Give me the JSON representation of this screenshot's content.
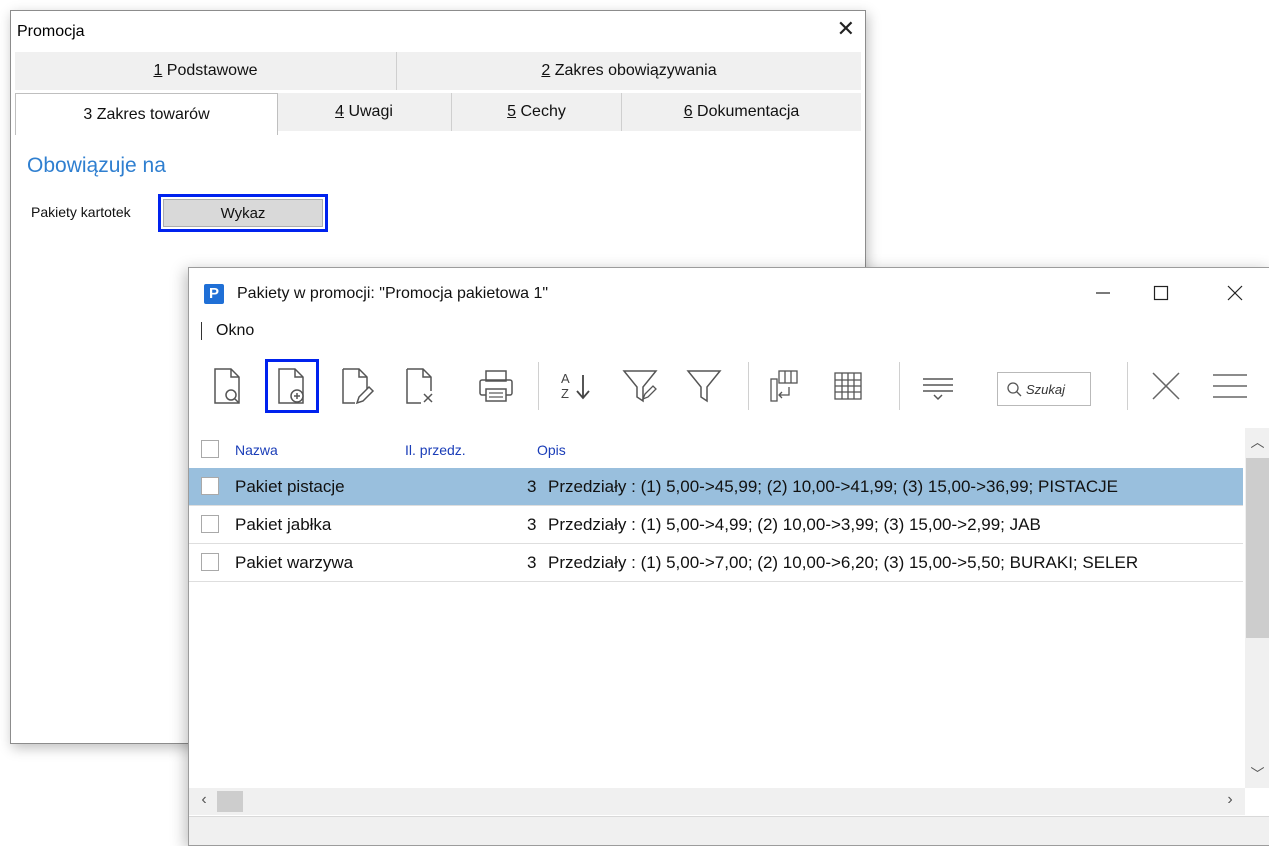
{
  "promocja": {
    "title": "Promocja",
    "tabs_row1": [
      {
        "num": "1",
        "label": " Podstawowe"
      },
      {
        "num": "2",
        "label": " Zakres obowiązywania"
      }
    ],
    "tabs_row2": [
      {
        "num": "3",
        "label": " Zakres towarów"
      },
      {
        "num": "4",
        "label": " Uwagi"
      },
      {
        "num": "5",
        "label": " Cechy"
      },
      {
        "num": "6",
        "label": " Dokumentacja"
      }
    ],
    "section_title": "Obowiązuje na",
    "field_label": "Pakiety kartotek",
    "wykaz_label": "Wykaz"
  },
  "pakiety": {
    "app_icon": "P",
    "title": "Pakiety w promocji: \"Promocja pakietowa 1\"",
    "menu": [
      "Okno"
    ],
    "search_placeholder": "Szukaj",
    "columns": [
      "Nazwa",
      "Il. przedz.",
      "Opis"
    ],
    "rows": [
      {
        "nazwa": "Pakiet pistacje",
        "il": "3",
        "opis": "Przedziały : (1) 5,00->45,99; (2) 10,00->41,99; (3) 15,00->36,99; PISTACJE",
        "selected": true
      },
      {
        "nazwa": "Pakiet jabłka",
        "il": "3",
        "opis": "Przedziały : (1) 5,00->4,99; (2) 10,00->3,99; (3) 15,00->2,99; JAB",
        "selected": false
      },
      {
        "nazwa": "Pakiet warzywa",
        "il": "3",
        "opis": "Przedziały : (1) 5,00->7,00; (2) 10,00->6,20; (3) 15,00->5,50; BURAKI; SELER",
        "selected": false
      }
    ]
  },
  "colors": {
    "accent": "#2f7fd0",
    "selection": "#99bfdd",
    "highlight": "#0022ee",
    "header_text": "#1a3db8"
  }
}
